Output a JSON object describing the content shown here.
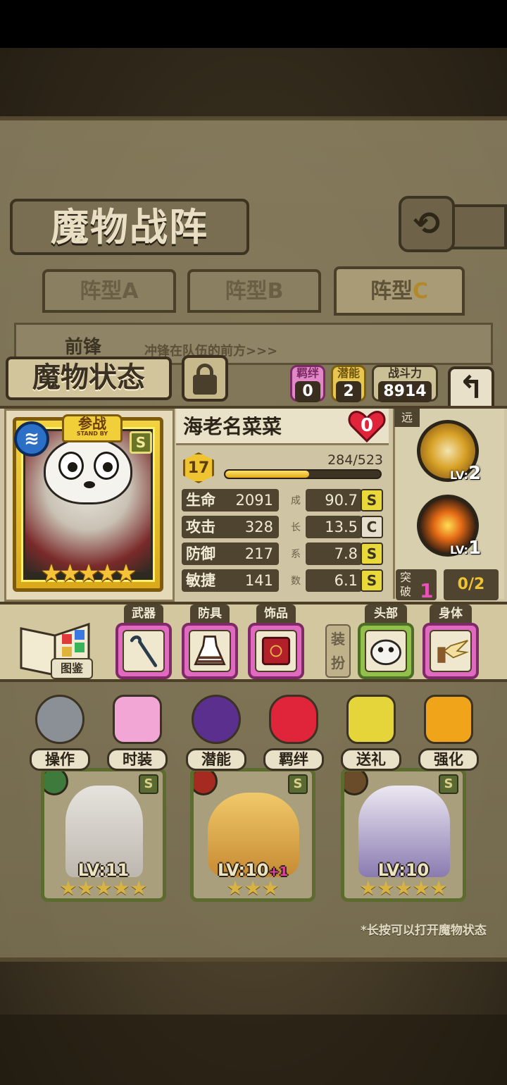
{
  "formation": {
    "title": "魔物战阵",
    "tabs": [
      {
        "label": "阵型",
        "letter": "A",
        "active": false
      },
      {
        "label": "阵型",
        "letter": "B",
        "active": false
      },
      {
        "label": "阵型",
        "letter": "C",
        "active": true
      }
    ],
    "row_label": "前锋",
    "row_desc": "冲锋在队伍的前方>>>",
    "members": [
      {
        "level": "LV:11",
        "plus": "",
        "grade": "S",
        "stars": "★★★★★",
        "element": "wood"
      },
      {
        "level": "LV:10",
        "plus": "+1",
        "grade": "S",
        "stars": "★★★",
        "element": "fire"
      },
      {
        "level": "LV:10",
        "plus": "",
        "grade": "S",
        "stars": "★★★★★",
        "element": "earth"
      }
    ],
    "hint": "*长按可以打开魔物状态"
  },
  "status": {
    "title": "魔物状态",
    "bond": {
      "label": "羁绊",
      "value": "0"
    },
    "potential": {
      "label": "潜能",
      "value": "2"
    },
    "power": {
      "label": "战斗力",
      "value": "8914"
    },
    "back_icon": "return-arrow-icon",
    "card": {
      "stand_by_cn": "参战",
      "stand_by_en": "STAND BY",
      "element": "water",
      "grade": "S",
      "stars": "★★★★★"
    },
    "name": "海老名菜菜",
    "affection": "0",
    "level": "17",
    "exp": "284/523",
    "exp_ratio": 0.543,
    "stats": [
      {
        "name": "生命",
        "value": "2091",
        "growth": "90.7",
        "grade": "S"
      },
      {
        "name": "攻击",
        "value": "328",
        "growth": "13.5",
        "grade": "C"
      },
      {
        "name": "防御",
        "value": "217",
        "growth": "7.8",
        "grade": "S"
      },
      {
        "name": "敏捷",
        "value": "141",
        "growth": "6.1",
        "grade": "S"
      }
    ],
    "coef_chars": [
      "成",
      "长",
      "系",
      "数"
    ],
    "range": "远",
    "skills": [
      {
        "lv_prefix": "LV:",
        "lv": "2"
      },
      {
        "lv_prefix": "LV:",
        "lv": "1"
      }
    ],
    "break_label": "突破",
    "break_value": "1",
    "break_count": "0/2"
  },
  "equipment": {
    "book_label": "图鉴",
    "slots": [
      {
        "tag": "武器",
        "icon": "crowbar-icon"
      },
      {
        "tag": "防具",
        "icon": "dress-armor-icon"
      },
      {
        "tag": "饰品",
        "icon": "red-book-icon"
      }
    ],
    "dress_label": "装扮",
    "dress_slots": [
      {
        "tag": "头部",
        "icon": "dog-head-icon"
      },
      {
        "tag": "身体",
        "icon": "winged-body-icon"
      }
    ]
  },
  "actions": [
    {
      "label": "操作",
      "icon": "gear-icon",
      "color": "#8b9096"
    },
    {
      "label": "时装",
      "icon": "outfit-icon",
      "color": "#f2a6d6"
    },
    {
      "label": "潜能",
      "icon": "demon-icon",
      "color": "#5b2f8e"
    },
    {
      "label": "羁绊",
      "icon": "hearts-icon",
      "color": "#e0243a"
    },
    {
      "label": "送礼",
      "icon": "gift-icon",
      "color": "#e6d53a"
    },
    {
      "label": "强化",
      "icon": "upgrade-arrows-icon",
      "color": "#f0a41a"
    }
  ]
}
